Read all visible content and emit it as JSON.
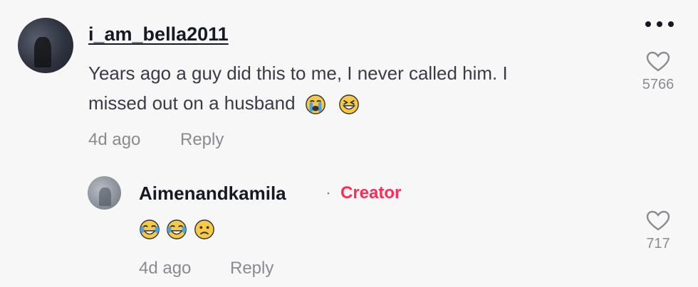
{
  "comment": {
    "username": "i_am_bella2011",
    "text_line1": "Years ago a guy did this to me, I never called him. I",
    "text_line2": "missed out on a husband",
    "emojis": [
      "loudly-crying-face",
      "grinning-squinting-face"
    ],
    "time": "4d ago",
    "reply_label": "Reply",
    "like_count": "5766"
  },
  "reply": {
    "username": "Aimenandkamila",
    "separator": "·",
    "badge": "Creator",
    "emojis": [
      "face-with-tears-of-joy",
      "face-with-tears-of-joy",
      "confused-face"
    ],
    "time": "4d ago",
    "reply_label": "Reply",
    "like_count": "717"
  },
  "colors": {
    "creator": "#fe2c55",
    "muted": "#8a8b91",
    "text": "#161823"
  }
}
